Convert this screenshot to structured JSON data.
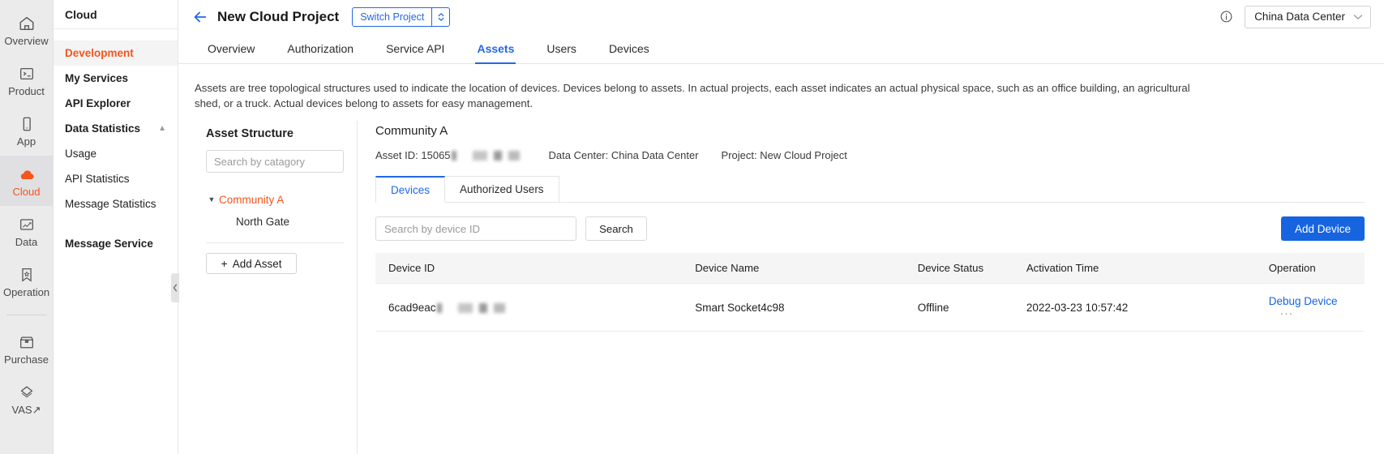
{
  "rail": {
    "items": [
      {
        "label": "Overview",
        "icon": "home-icon",
        "active": false
      },
      {
        "label": "Product",
        "icon": "terminal-icon",
        "active": false
      },
      {
        "label": "App",
        "icon": "phone-icon",
        "active": false
      },
      {
        "label": "Cloud",
        "icon": "cloud-icon",
        "active": true
      },
      {
        "label": "Data",
        "icon": "chart-box-icon",
        "active": false
      },
      {
        "label": "Operation",
        "icon": "bookmark-star-icon",
        "active": false
      },
      {
        "label": "Purchase",
        "icon": "package-box-icon",
        "active": false
      },
      {
        "label": "VAS",
        "icon": "diamond-external-icon",
        "active": false
      }
    ]
  },
  "subnav": {
    "title": "Cloud",
    "items": [
      {
        "label": "Development",
        "state": "active"
      },
      {
        "label": "My Services",
        "state": "bold"
      },
      {
        "label": "API Explorer",
        "state": "bold"
      },
      {
        "label": "Data Statistics",
        "state": "group",
        "caret": "▲"
      },
      {
        "label": "Usage",
        "state": "plain"
      },
      {
        "label": "API Statistics",
        "state": "plain"
      },
      {
        "label": "Message Statistics",
        "state": "plain"
      },
      {
        "label": "Message Service",
        "state": "bold"
      }
    ]
  },
  "header": {
    "back_icon": "back-arrow-icon",
    "project_title": "New Cloud Project",
    "switch_project_label": "Switch Project",
    "switch_project_icon": "updown-chevron-icon",
    "info_icon": "info-circle-icon",
    "data_center_value": "China Data Center",
    "data_center_chevron": "chevron-down-icon"
  },
  "tabs": [
    {
      "label": "Overview",
      "active": false
    },
    {
      "label": "Authorization",
      "active": false
    },
    {
      "label": "Service API",
      "active": false
    },
    {
      "label": "Assets",
      "active": true
    },
    {
      "label": "Users",
      "active": false
    },
    {
      "label": "Devices",
      "active": false
    }
  ],
  "description": "Assets are tree topological structures used to indicate the location of devices. Devices belong to assets. In actual projects, each asset indicates an actual physical space, such as an office building, an agricultural shed, or a truck. Actual devices belong to assets for easy management.",
  "asset_panel": {
    "title": "Asset Structure",
    "search_placeholder": "Search by catagory",
    "search_value": "",
    "tree": [
      {
        "label": "Community A",
        "level": 0,
        "expanded": true,
        "selected": true,
        "caret": "▼"
      },
      {
        "label": "North Gate",
        "level": 1,
        "expanded": false,
        "selected": false
      }
    ],
    "add_asset_label": "Add Asset",
    "add_asset_icon": "plus-icon",
    "collapse_handle_icon": "chevron-left-icon"
  },
  "detail": {
    "asset_name": "Community A",
    "meta": [
      {
        "label": "Asset ID:",
        "value": "15065",
        "redacted": true
      },
      {
        "label": "Data Center:",
        "value": "China Data Center",
        "redacted": false
      },
      {
        "label": "Project:",
        "value": "New Cloud Project",
        "redacted": false
      }
    ],
    "subtabs": [
      {
        "label": "Devices",
        "active": true
      },
      {
        "label": "Authorized Users",
        "active": false
      }
    ],
    "toolbar": {
      "search_placeholder": "Search by device ID",
      "search_value": "",
      "search_button_label": "Search",
      "add_device_label": "Add Device"
    },
    "table": {
      "columns": [
        "Device ID",
        "Device Name",
        "Device Status",
        "Activation Time",
        "Operation"
      ],
      "rows": [
        {
          "device_id": "6cad9eac",
          "device_id_redacted": true,
          "device_name": "Smart Socket4c98",
          "device_status": "Offline",
          "activation_time": "2022-03-23 10:57:42",
          "operation_link": "Debug Device",
          "operation_more": "···"
        }
      ]
    }
  },
  "colors": {
    "accent_orange": "#f5551b",
    "accent_blue": "#2268e8",
    "button_blue": "#1664e0",
    "rail_bg": "#ebebeb",
    "table_header_bg": "#f5f5f5"
  }
}
